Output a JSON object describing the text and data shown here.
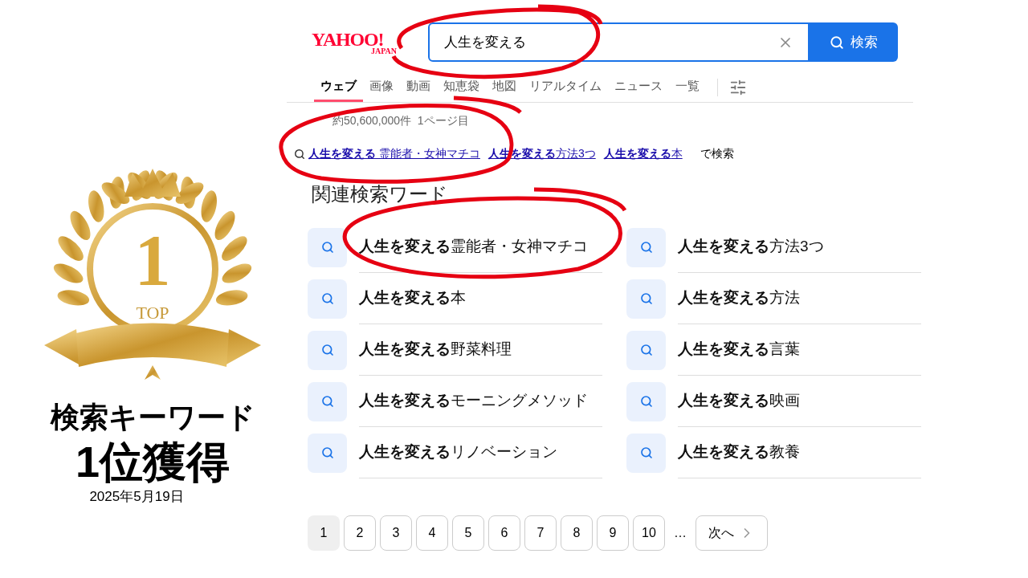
{
  "badge": {
    "rank": "1",
    "label": "TOP"
  },
  "award": {
    "title": "検索キーワード",
    "rank_text": "1位獲得",
    "date": "2025年5月19日"
  },
  "logo": {
    "main": "YAHOO!",
    "sub": "JAPAN"
  },
  "search": {
    "value": "人生を変える",
    "button": "検索"
  },
  "tabs": [
    {
      "label": "ウェブ",
      "selected": true
    },
    {
      "label": "画像",
      "selected": false
    },
    {
      "label": "動画",
      "selected": false
    },
    {
      "label": "知恵袋",
      "selected": false
    },
    {
      "label": "地図",
      "selected": false
    },
    {
      "label": "リアルタイム",
      "selected": false
    },
    {
      "label": "ニュース",
      "selected": false
    },
    {
      "label": "一覧",
      "selected": false
    }
  ],
  "result_count": "約50,600,000件  1ページ目",
  "suggest_links": [
    "**人生を変える** 霊能者・女神マチコ",
    "**人生を変える**方法3つ",
    "**人生を変える**本"
  ],
  "suggest_suffix": "で検索",
  "related_heading": "関連検索ワード",
  "related": [
    "**人生を変える** 霊能者・女神マチコ",
    "**人生を変える**方法3つ",
    "**人生を変える**本",
    "**人生を変える**方法",
    "**人生を変える**野菜料理",
    "**人生を変える**言葉",
    "**人生を変える**モーニングメソッド",
    "**人生を変える**映画",
    "**人生を変える**リノベーション",
    "**人生を変える**教養"
  ],
  "pagination": {
    "pages": [
      {
        "label": "1",
        "selected": true
      },
      {
        "label": "2",
        "selected": false
      },
      {
        "label": "3",
        "selected": false
      },
      {
        "label": "4",
        "selected": false
      },
      {
        "label": "5",
        "selected": false
      },
      {
        "label": "6",
        "selected": false
      },
      {
        "label": "7",
        "selected": false
      },
      {
        "label": "8",
        "selected": false
      },
      {
        "label": "9",
        "selected": false
      },
      {
        "label": "10",
        "selected": false
      }
    ],
    "ellipsis": "…",
    "next": "次へ"
  }
}
